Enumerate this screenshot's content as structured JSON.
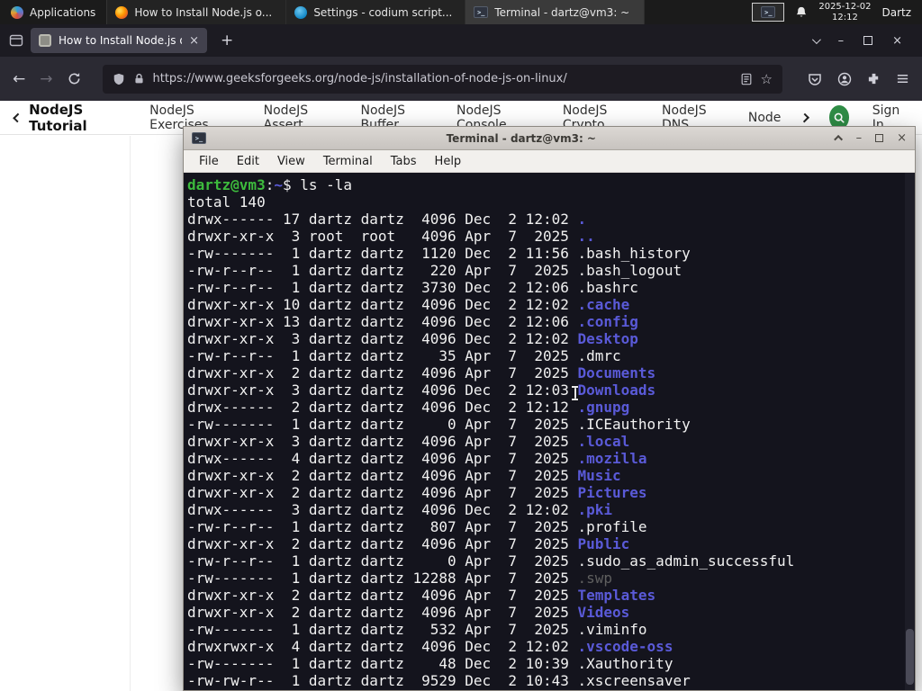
{
  "glyphs": {
    "close": "×",
    "minimize": "–",
    "new_tab": "+",
    "back": "←",
    "forward": "→",
    "star": "☆",
    "term_icon": ">_"
  },
  "taskbar": {
    "applications_label": "Applications",
    "windows": [
      {
        "title": "How to Install Node.js o..."
      },
      {
        "title": "Settings - codium script..."
      },
      {
        "title": "Terminal - dartz@vm3: ~"
      }
    ],
    "date": "2025-12-02",
    "time": "12:12",
    "user": "Dartz"
  },
  "browser": {
    "tab_title": "How to Install Node.js on",
    "url": "https://www.geeksforgeeks.org/node-js/installation-of-node-js-on-linux/"
  },
  "sitenav": {
    "items": [
      "NodeJS Tutorial",
      "NodeJS Exercises",
      "NodeJS Assert",
      "NodeJS Buffer",
      "NodeJS Console",
      "NodeJS Crypto",
      "NodeJS DNS",
      "Node"
    ],
    "signin_label": "Sign In"
  },
  "terminal": {
    "title": "Terminal - dartz@vm3: ~",
    "menus": [
      "File",
      "Edit",
      "View",
      "Terminal",
      "Tabs",
      "Help"
    ],
    "prompt_user": "dartz@vm3",
    "prompt_sep": ":",
    "prompt_path": "~",
    "prompt_dollar": "$ ",
    "command": "ls -la",
    "total_line": "total 140",
    "listing": [
      {
        "pre": "drwx------ 17 dartz dartz  4096 Dec  2 12:02 ",
        "name": ".",
        "kind": "dir"
      },
      {
        "pre": "drwxr-xr-x  3 root  root   4096 Apr  7  2025 ",
        "name": "..",
        "kind": "dir"
      },
      {
        "pre": "-rw-------  1 dartz dartz  1120 Dec  2 11:56 ",
        "name": ".bash_history",
        "kind": "file"
      },
      {
        "pre": "-rw-r--r--  1 dartz dartz   220 Apr  7  2025 ",
        "name": ".bash_logout",
        "kind": "file"
      },
      {
        "pre": "-rw-r--r--  1 dartz dartz  3730 Dec  2 12:06 ",
        "name": ".bashrc",
        "kind": "file"
      },
      {
        "pre": "drwxr-xr-x 10 dartz dartz  4096 Dec  2 12:02 ",
        "name": ".cache",
        "kind": "dir"
      },
      {
        "pre": "drwxr-xr-x 13 dartz dartz  4096 Dec  2 12:06 ",
        "name": ".config",
        "kind": "dir"
      },
      {
        "pre": "drwxr-xr-x  3 dartz dartz  4096 Dec  2 12:02 ",
        "name": "Desktop",
        "kind": "dir"
      },
      {
        "pre": "-rw-r--r--  1 dartz dartz    35 Apr  7  2025 ",
        "name": ".dmrc",
        "kind": "file"
      },
      {
        "pre": "drwxr-xr-x  2 dartz dartz  4096 Apr  7  2025 ",
        "name": "Documents",
        "kind": "dir"
      },
      {
        "pre": "drwxr-xr-x  3 dartz dartz  4096 Dec  2 12:03 ",
        "name": "Downloads",
        "kind": "dir"
      },
      {
        "pre": "drwx------  2 dartz dartz  4096 Dec  2 12:12 ",
        "name": ".gnupg",
        "kind": "dir"
      },
      {
        "pre": "-rw-------  1 dartz dartz     0 Apr  7  2025 ",
        "name": ".ICEauthority",
        "kind": "file"
      },
      {
        "pre": "drwxr-xr-x  3 dartz dartz  4096 Apr  7  2025 ",
        "name": ".local",
        "kind": "dir"
      },
      {
        "pre": "drwx------  4 dartz dartz  4096 Apr  7  2025 ",
        "name": ".mozilla",
        "kind": "dir"
      },
      {
        "pre": "drwxr-xr-x  2 dartz dartz  4096 Apr  7  2025 ",
        "name": "Music",
        "kind": "dir"
      },
      {
        "pre": "drwxr-xr-x  2 dartz dartz  4096 Apr  7  2025 ",
        "name": "Pictures",
        "kind": "dir"
      },
      {
        "pre": "drwx------  3 dartz dartz  4096 Dec  2 12:02 ",
        "name": ".pki",
        "kind": "dir"
      },
      {
        "pre": "-rw-r--r--  1 dartz dartz   807 Apr  7  2025 ",
        "name": ".profile",
        "kind": "file"
      },
      {
        "pre": "drwxr-xr-x  2 dartz dartz  4096 Apr  7  2025 ",
        "name": "Public",
        "kind": "dir"
      },
      {
        "pre": "-rw-r--r--  1 dartz dartz     0 Apr  7  2025 ",
        "name": ".sudo_as_admin_successful",
        "kind": "file"
      },
      {
        "pre": "-rw-------  1 dartz dartz 12288 Apr  7  2025 ",
        "name": ".swp",
        "kind": "dim"
      },
      {
        "pre": "drwxr-xr-x  2 dartz dartz  4096 Apr  7  2025 ",
        "name": "Templates",
        "kind": "dir"
      },
      {
        "pre": "drwxr-xr-x  2 dartz dartz  4096 Apr  7  2025 ",
        "name": "Videos",
        "kind": "dir"
      },
      {
        "pre": "-rw-------  1 dartz dartz   532 Apr  7  2025 ",
        "name": ".viminfo",
        "kind": "file"
      },
      {
        "pre": "drwxrwxr-x  4 dartz dartz  4096 Dec  2 12:02 ",
        "name": ".vscode-oss",
        "kind": "dir"
      },
      {
        "pre": "-rw-------  1 dartz dartz    48 Dec  2 10:39 ",
        "name": ".Xauthority",
        "kind": "file"
      },
      {
        "pre": "-rw-rw-r--  1 dartz dartz  9529 Dec  2 10:43 ",
        "name": ".xscreensaver",
        "kind": "file"
      }
    ]
  }
}
